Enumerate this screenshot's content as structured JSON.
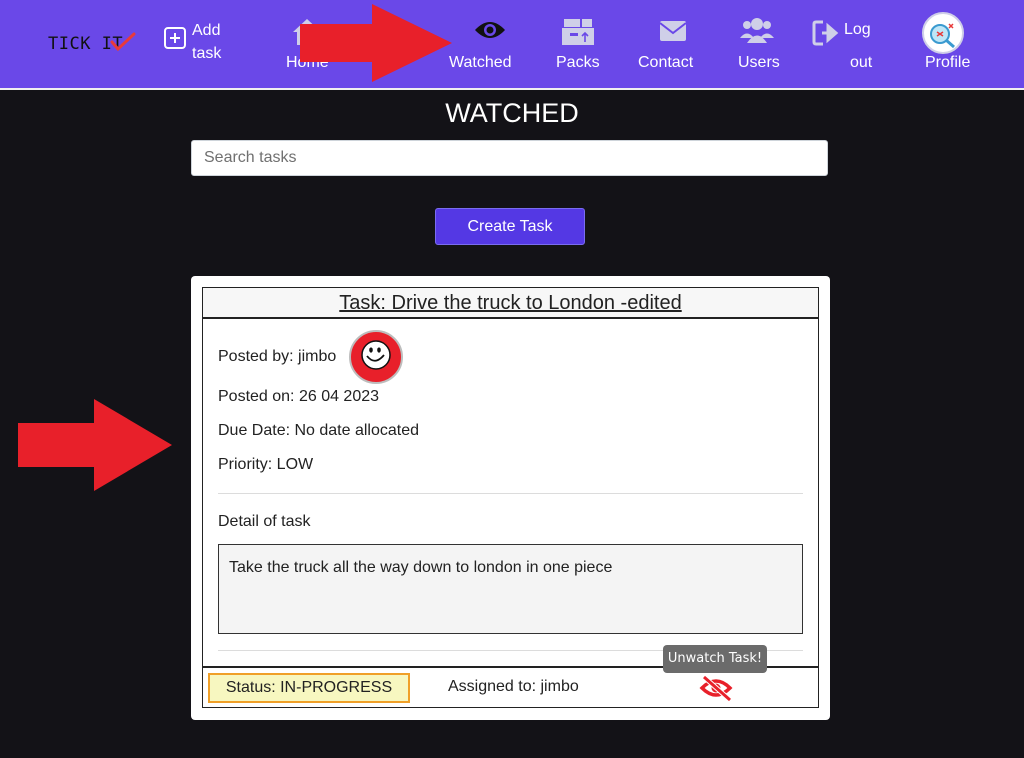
{
  "navbar": {
    "brand": "TICK IT",
    "add_task": [
      "Add",
      "task"
    ],
    "home": "Home",
    "watched": "Watched",
    "packs": "Packs",
    "contact": "Contact",
    "users": "Users",
    "logout": [
      "Log",
      "out"
    ],
    "profile": "Profile"
  },
  "page": {
    "title": "WATCHED",
    "search_placeholder": "Search tasks",
    "create_button": "Create Task"
  },
  "task": {
    "title": "Task: Drive the truck to London -edited",
    "posted_by": "Posted by: jimbo",
    "posted_on": "Posted on: 26 04 2023",
    "due_date": "Due Date: No date allocated",
    "priority": "Priority: LOW",
    "detail_label": "Detail of task",
    "detail": "Take the truck all the way down to london in one piece",
    "status": "Status: IN-PROGRESS",
    "assigned": "Assigned to: jimbo",
    "tooltip": "Unwatch Task!"
  },
  "colors": {
    "navbar": "#6a48e8",
    "background": "#131217",
    "button": "#5438e4",
    "accent_red": "#e8202a",
    "status_border": "#f0a028"
  }
}
